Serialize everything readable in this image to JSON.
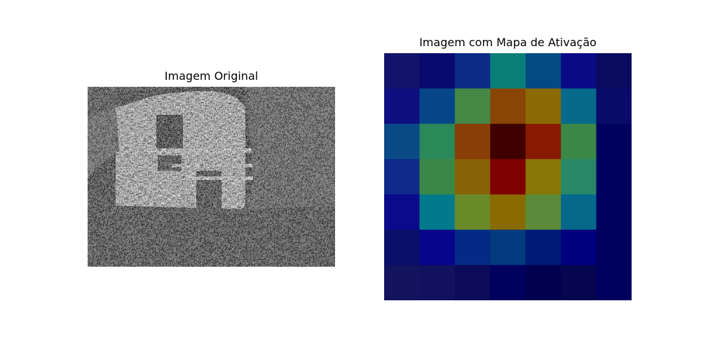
{
  "panels": {
    "left": {
      "title": "Imagem Original"
    },
    "right": {
      "title": "Imagem com Mapa de Ativação"
    }
  },
  "activation_map": {
    "colormap": "jet",
    "rows": 7,
    "cols": 7,
    "cell_colors": [
      [
        "#13136b",
        "#0a0a6e",
        "#0a2a86",
        "#0a7f78",
        "#034a84",
        "#0a0a86",
        "#0a0a5e"
      ],
      [
        "#0f0f80",
        "#064688",
        "#458845",
        "#894505",
        "#896a05",
        "#066a8a",
        "#0a0a6a"
      ],
      [
        "#0a4a86",
        "#2b8858",
        "#883e05",
        "#400000",
        "#881a00",
        "#3b8848",
        "#00005e"
      ],
      [
        "#0f2a8a",
        "#3a8848",
        "#886005",
        "#7f0000",
        "#887705",
        "#288868",
        "#00005e"
      ],
      [
        "#0a0a8a",
        "#007a8a",
        "#6a8a2a",
        "#886a00",
        "#5a8a3a",
        "#06688a",
        "#00005e"
      ],
      [
        "#0a0f6a",
        "#06068a",
        "#042a86",
        "#043a7f",
        "#001a78",
        "#00007f",
        "#00005e"
      ],
      [
        "#13135e",
        "#11115e",
        "#0b0b5a",
        "#00005e",
        "#00004e",
        "#06064f",
        "#00005e"
      ]
    ]
  }
}
